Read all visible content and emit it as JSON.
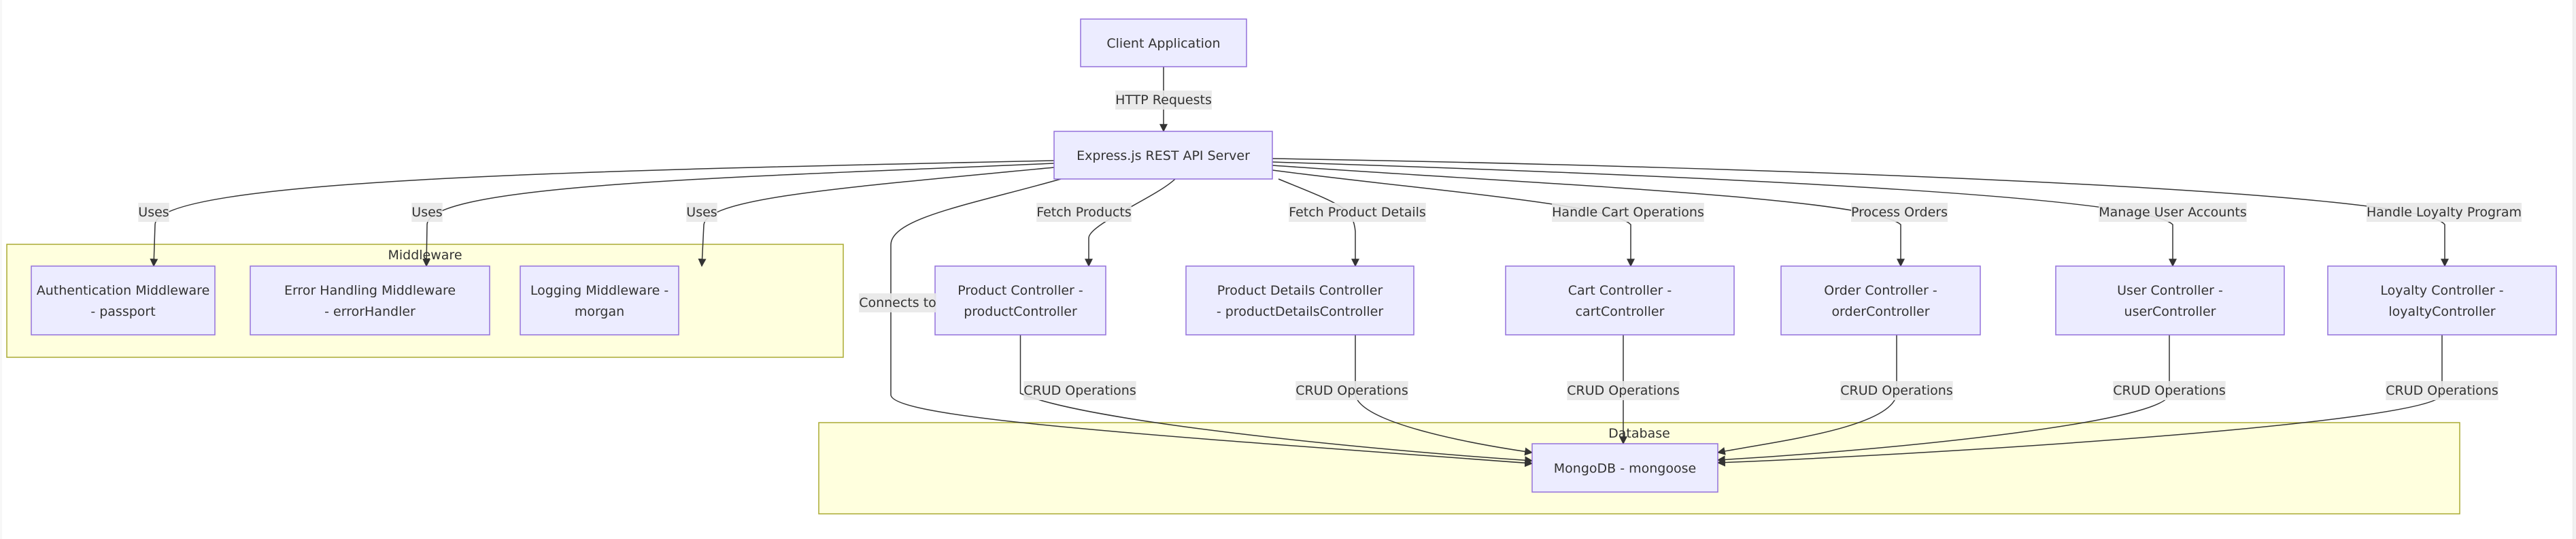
{
  "diagram": {
    "type": "flowchart",
    "colors": {
      "node_fill": "#ececff",
      "node_stroke": "#9370db",
      "cluster_fill": "#ffffde",
      "cluster_stroke": "#aaaa33",
      "edge": "#333333",
      "edge_label_bg": "#e8e8e8",
      "text": "#333333"
    },
    "clusters": [
      {
        "id": "middleware",
        "label": "Middleware"
      },
      {
        "id": "database",
        "label": "Database"
      }
    ],
    "nodes": [
      {
        "id": "client",
        "lines": [
          "Client Application"
        ]
      },
      {
        "id": "server",
        "lines": [
          "Express.js REST API Server"
        ]
      },
      {
        "id": "auth",
        "cluster": "middleware",
        "lines": [
          "Authentication Middleware",
          "- passport"
        ]
      },
      {
        "id": "error",
        "cluster": "middleware",
        "lines": [
          "Error Handling Middleware",
          "- errorHandler"
        ]
      },
      {
        "id": "logging",
        "cluster": "middleware",
        "lines": [
          "Logging Middleware -",
          "morgan"
        ]
      },
      {
        "id": "product",
        "lines": [
          "Product Controller -",
          "productController"
        ]
      },
      {
        "id": "productDetails",
        "lines": [
          "Product Details Controller",
          "- productDetailsController"
        ]
      },
      {
        "id": "cart",
        "lines": [
          "Cart Controller -",
          "cartController"
        ]
      },
      {
        "id": "order",
        "lines": [
          "Order Controller -",
          "orderController"
        ]
      },
      {
        "id": "user",
        "lines": [
          "User Controller -",
          "userController"
        ]
      },
      {
        "id": "loyalty",
        "lines": [
          "Loyalty Controller -",
          "loyaltyController"
        ]
      },
      {
        "id": "mongo",
        "cluster": "database",
        "lines": [
          "MongoDB - mongoose"
        ]
      }
    ],
    "edges": [
      {
        "from": "client",
        "to": "server",
        "label": "HTTP Requests"
      },
      {
        "from": "server",
        "to": "auth",
        "label": "Uses"
      },
      {
        "from": "server",
        "to": "error",
        "label": "Uses"
      },
      {
        "from": "server",
        "to": "logging",
        "label": "Uses"
      },
      {
        "from": "server",
        "to": "mongo",
        "label": "Connects to"
      },
      {
        "from": "server",
        "to": "product",
        "label": "Fetch Products"
      },
      {
        "from": "server",
        "to": "productDetails",
        "label": "Fetch Product Details"
      },
      {
        "from": "server",
        "to": "cart",
        "label": "Handle Cart Operations"
      },
      {
        "from": "server",
        "to": "order",
        "label": "Process Orders"
      },
      {
        "from": "server",
        "to": "user",
        "label": "Manage User Accounts"
      },
      {
        "from": "server",
        "to": "loyalty",
        "label": "Handle Loyalty Program"
      },
      {
        "from": "product",
        "to": "mongo",
        "label": "CRUD Operations"
      },
      {
        "from": "productDetails",
        "to": "mongo",
        "label": "CRUD Operations"
      },
      {
        "from": "cart",
        "to": "mongo",
        "label": "CRUD Operations"
      },
      {
        "from": "order",
        "to": "mongo",
        "label": "CRUD Operations"
      },
      {
        "from": "user",
        "to": "mongo",
        "label": "CRUD Operations"
      },
      {
        "from": "loyalty",
        "to": "mongo",
        "label": "CRUD Operations"
      }
    ]
  }
}
